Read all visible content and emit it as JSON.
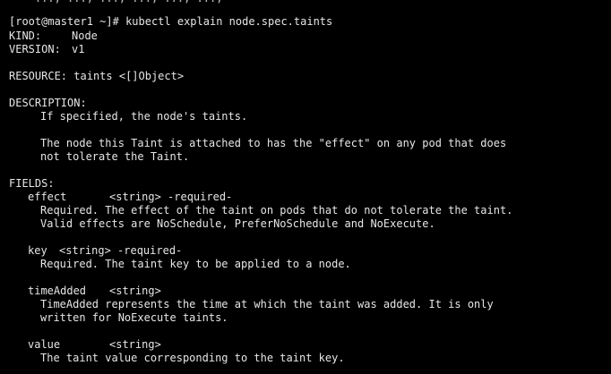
{
  "terminal": {
    "partial_top": "    ..., ..., ..., ..., ..., ...,",
    "prompt": "[root@master1 ~]#",
    "command": "kubectl explain node.spec.taints",
    "kind_label": "KIND:",
    "kind_value": "Node",
    "version_label": "VERSION:",
    "version_value": "v1",
    "resource_label": "RESOURCE:",
    "resource_value": "taints <[]Object>",
    "description_label": "DESCRIPTION:",
    "description_lines": [
      "If specified, the node's taints.",
      "The node this Taint is attached to has the \"effect\" on any pod that does",
      "not tolerate the Taint."
    ],
    "fields_label": "FIELDS:",
    "fields": [
      {
        "name": "effect",
        "type": "<string> -required-",
        "desc": [
          "Required. The effect of the taint on pods that do not tolerate the taint.",
          "Valid effects are NoSchedule, PreferNoSchedule and NoExecute."
        ]
      },
      {
        "name": "key",
        "type": "<string> -required-",
        "desc": [
          "Required. The taint key to be applied to a node."
        ]
      },
      {
        "name": "timeAdded",
        "type": "<string>",
        "desc": [
          "TimeAdded represents the time at which the taint was added. It is only",
          "written for NoExecute taints."
        ]
      },
      {
        "name": "value",
        "type": "<string>",
        "desc": [
          "The taint value corresponding to the taint key."
        ]
      }
    ]
  }
}
